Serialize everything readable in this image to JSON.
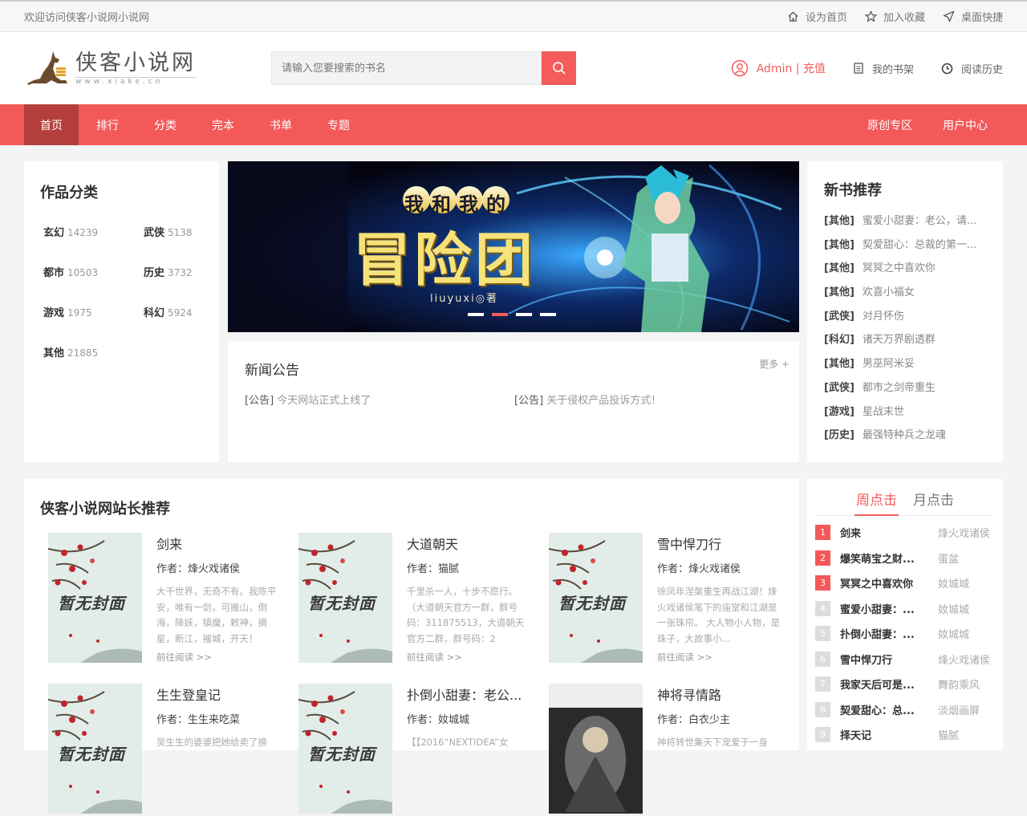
{
  "topbar": {
    "welcome": "欢迎访问侠客小说网小说网",
    "set_home": "设为首页",
    "add_fav": "加入收藏",
    "desktop": "桌面快捷"
  },
  "logo": {
    "name": "侠客小说网",
    "url": "www.xiake.cn"
  },
  "search": {
    "placeholder": "请输入您要搜索的书名"
  },
  "header": {
    "user": "Admin | 充值",
    "bookshelf": "我的书架",
    "history": "阅读历史"
  },
  "nav": {
    "left": [
      "首页",
      "排行",
      "分类",
      "完本",
      "书单",
      "专题"
    ],
    "right": [
      "原创专区",
      "用户中心"
    ]
  },
  "categories": {
    "title": "作品分类",
    "items": [
      {
        "name": "玄幻",
        "count": "14239"
      },
      {
        "name": "武侠",
        "count": "5138"
      },
      {
        "name": "都市",
        "count": "10503"
      },
      {
        "name": "历史",
        "count": "3732"
      },
      {
        "name": "游戏",
        "count": "1975"
      },
      {
        "name": "科幻",
        "count": "5924"
      },
      {
        "name": "其他",
        "count": "21885"
      }
    ]
  },
  "banner": {
    "title_small": "我和我的",
    "title_big": "冒险团",
    "author": "liuyuxi◎著"
  },
  "news": {
    "title": "新闻公告",
    "more": "更多 +",
    "items": [
      {
        "tag": "[公告]",
        "text": "今天网站正式上线了"
      },
      {
        "tag": "[公告]",
        "text": "关于侵权产品投诉方式！"
      }
    ]
  },
  "new_books": {
    "title": "新书推荐",
    "items": [
      {
        "tag": "[其他]",
        "name": "蜜爱小甜妻：老公，请..."
      },
      {
        "tag": "[其他]",
        "name": "契爱甜心：总裁的第一..."
      },
      {
        "tag": "[其他]",
        "name": "冥冥之中喜欢你"
      },
      {
        "tag": "[其他]",
        "name": "欢喜小福女"
      },
      {
        "tag": "[武侠]",
        "name": "对月怀伤"
      },
      {
        "tag": "[科幻]",
        "name": "诸天万界剧透群"
      },
      {
        "tag": "[其他]",
        "name": "男巫阿米妥"
      },
      {
        "tag": "[武侠]",
        "name": "都市之剑帝重生"
      },
      {
        "tag": "[游戏]",
        "name": "星战末世"
      },
      {
        "tag": "[历史]",
        "name": "最强特种兵之龙魂"
      }
    ]
  },
  "recommend": {
    "title": "侠客小说网站长推荐",
    "cover_text": "暂无封面",
    "read_label": "前往阅读 >>",
    "books": [
      {
        "title": "剑来",
        "author": "作者：烽火戏诸侯",
        "desc": "大千世界，无奇不有。我陈平安，唯有一剑，可搬山，倒海，降妖，镇魔，敕神，摘星，断江，摧城，开天！"
      },
      {
        "title": "大道朝天",
        "author": "作者：猫腻",
        "desc": "千里杀一人，十步不愿行。（大道朝天官方一群，群号码：311875513，大道朝天官方二群，群号码：2"
      },
      {
        "title": "雪中悍刀行",
        "author": "作者：烽火戏诸侯",
        "desc": "徐凤年涅槃重生再战江湖！烽火戏诸侯笔下的庙堂和江湖是一张珠帘。 大人物小人物，是珠子，大故事小..."
      },
      {
        "title": "生生登皇记",
        "author": "作者：生生来吃菜",
        "desc": "吴生生的婆婆把她给卖了换"
      },
      {
        "title": "扑倒小甜妻：老公...",
        "author": "作者：奻城城",
        "desc": "【【2016“NEXTIDEA”女"
      },
      {
        "title": "神将寻情路",
        "author": "作者：白衣少主",
        "desc": "神将转世集天下宠爱于一身"
      }
    ]
  },
  "rank": {
    "tab_week": "周点击",
    "tab_month": "月点击",
    "items": [
      {
        "num": "1",
        "name": "剑来",
        "author": "烽火戏诸侯"
      },
      {
        "num": "2",
        "name": "爆笑萌宝之财...",
        "author": "蛋盆"
      },
      {
        "num": "3",
        "name": "冥冥之中喜欢你",
        "author": "奻城城"
      },
      {
        "num": "4",
        "name": "蜜爱小甜妻：...",
        "author": "奻城城"
      },
      {
        "num": "5",
        "name": "扑倒小甜妻：...",
        "author": "奻城城"
      },
      {
        "num": "6",
        "name": "雪中悍刀行",
        "author": "烽火戏诸侯"
      },
      {
        "num": "7",
        "name": "我家天后可是...",
        "author": "舞韵乘风"
      },
      {
        "num": "8",
        "name": "契爱甜心：总...",
        "author": "淡烟画屏"
      },
      {
        "num": "9",
        "name": "择天记",
        "author": "猫腻"
      }
    ]
  },
  "colors": {
    "accent": "#f45959",
    "nav_active": "#b53f3c"
  }
}
